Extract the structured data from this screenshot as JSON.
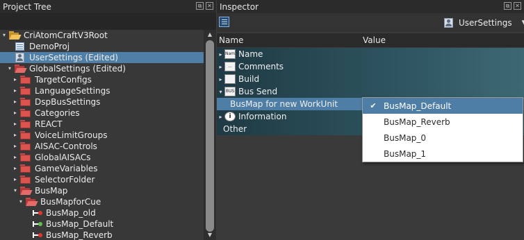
{
  "project_tree": {
    "title": "Project Tree",
    "items": [
      {
        "label": "CriAtomCraftV3Root",
        "icon": "folder-open-yellow",
        "expander": "▾",
        "indent": 0
      },
      {
        "label": "DemoProj",
        "icon": "project-icon",
        "expander": "",
        "indent": 1
      },
      {
        "label": "UserSettings (Edited)",
        "icon": "user-settings-icon",
        "expander": "",
        "indent": 1,
        "selected": true
      },
      {
        "label": "GlobalSettings (Edited)",
        "icon": "folder-open-red",
        "expander": "▾",
        "indent": 1
      },
      {
        "label": "TargetConfigs",
        "icon": "folder-red",
        "expander": "▸",
        "indent": 2
      },
      {
        "label": "LanguageSettings",
        "icon": "folder-red",
        "expander": "▸",
        "indent": 2
      },
      {
        "label": "DspBusSettings",
        "icon": "folder-red",
        "expander": "▸",
        "indent": 2
      },
      {
        "label": "Categories",
        "icon": "folder-red",
        "expander": "▸",
        "indent": 2
      },
      {
        "label": "REACT",
        "icon": "folder-red",
        "expander": "▸",
        "indent": 2
      },
      {
        "label": "VoiceLimitGroups",
        "icon": "folder-red",
        "expander": "▸",
        "indent": 2
      },
      {
        "label": "AISAC-Controls",
        "icon": "folder-red",
        "expander": "▸",
        "indent": 2
      },
      {
        "label": "GlobalAISACs",
        "icon": "folder-red",
        "expander": "▸",
        "indent": 2
      },
      {
        "label": "GameVariables",
        "icon": "folder-red",
        "expander": "▸",
        "indent": 2
      },
      {
        "label": "SelectorFolder",
        "icon": "folder-red",
        "expander": "▸",
        "indent": 2
      },
      {
        "label": "BusMap",
        "icon": "folder-open-red",
        "expander": "▾",
        "indent": 2
      },
      {
        "label": "BusMapforCue",
        "icon": "folder-open-red",
        "expander": "▾",
        "indent": 3
      },
      {
        "label": "BusMap_old",
        "icon": "busmap-red-icon",
        "expander": "",
        "indent": 4
      },
      {
        "label": "BusMap_Default",
        "icon": "busmap-green-icon",
        "expander": "",
        "indent": 4
      },
      {
        "label": "BusMap_Reverb",
        "icon": "busmap-red-icon",
        "expander": "",
        "indent": 4
      }
    ]
  },
  "inspector": {
    "title": "Inspector",
    "target": "UserSettings",
    "columns": {
      "name": "Name",
      "value": "Value"
    },
    "rows": [
      {
        "label": "Name",
        "icon_text": "Name",
        "expander": "▸",
        "style": "group"
      },
      {
        "label": "Comments",
        "icon_text": "...",
        "expander": "▸",
        "style": "group"
      },
      {
        "label": "Build",
        "icon_text": "",
        "expander": "▸",
        "style": "group"
      },
      {
        "label": "Bus Send",
        "icon_text": "BUS",
        "expander": "▾",
        "style": "group"
      },
      {
        "label": "BusMap for new WorkUnit",
        "icon_text": "",
        "expander": "",
        "style": "highlight"
      },
      {
        "label": "Information",
        "icon_text": "i",
        "expander": "▸",
        "style": "group"
      },
      {
        "label": "Other",
        "icon_text": "",
        "expander": "",
        "style": "group"
      }
    ],
    "dropdown": {
      "options": [
        "BusMap_Default",
        "BusMap_Reverb",
        "BusMap_0",
        "BusMap_1"
      ],
      "selected": "BusMap_Default"
    }
  }
}
